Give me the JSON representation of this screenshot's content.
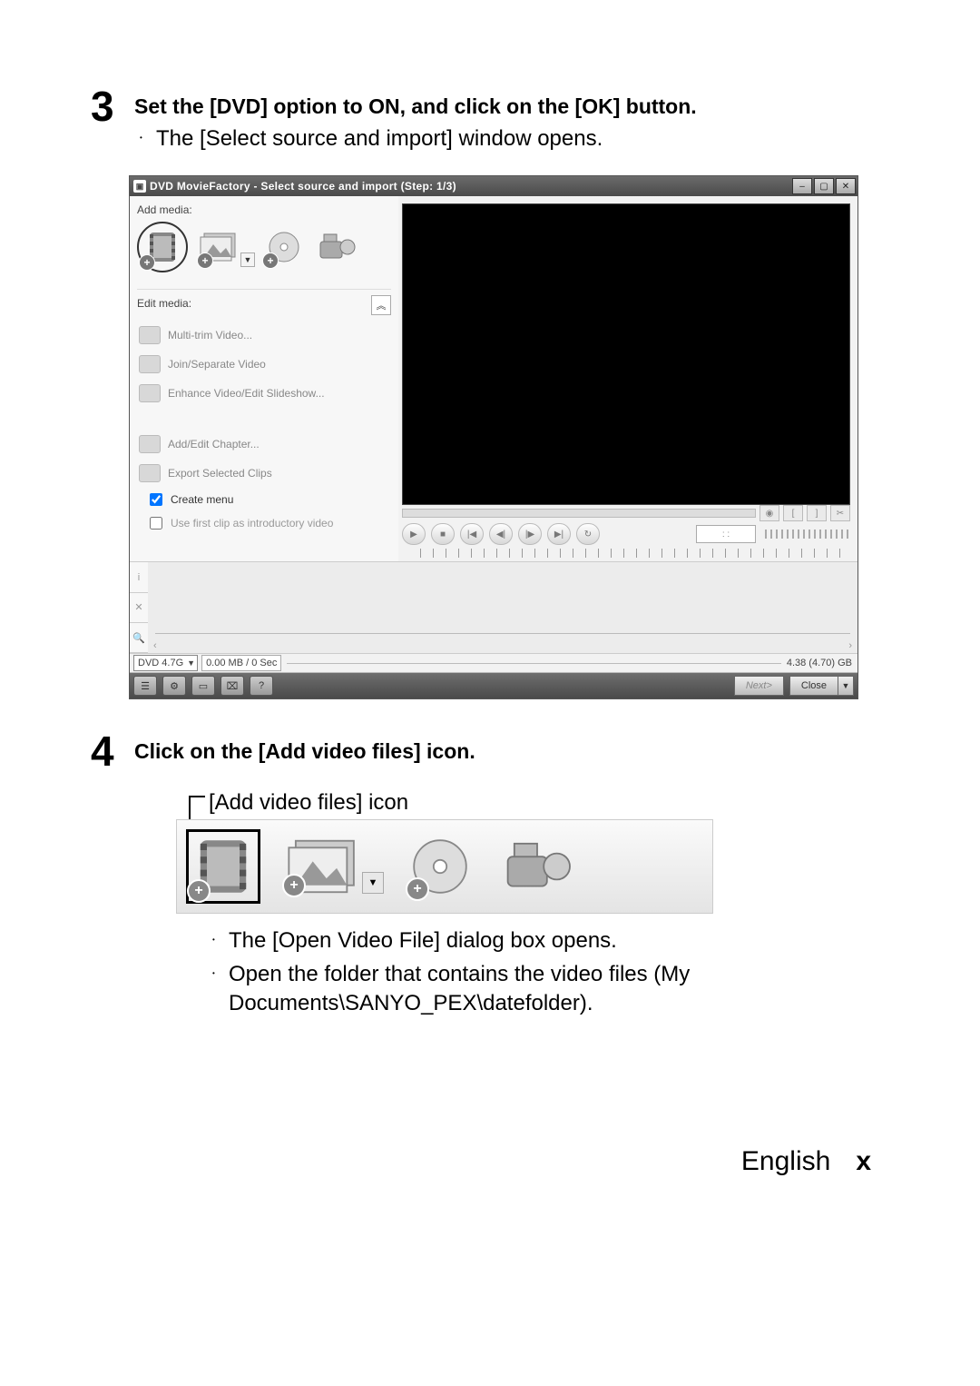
{
  "step3": {
    "num": "3",
    "title": "Set the [DVD] option to ON, and click on the [OK] button.",
    "bullet1": "The [Select source and import] window opens."
  },
  "step4": {
    "num": "4",
    "title": "Click on the [Add video files] icon.",
    "callout_label": "[Add video files] icon",
    "bullet1": "The [Open Video File] dialog box opens.",
    "bullet2": "Open the folder that contains the video files (My Documents\\SANYO_PEX\\datefolder)."
  },
  "app": {
    "title": "DVD MovieFactory - Select source and import (Step: 1/3)",
    "left": {
      "add_label": "Add media:",
      "edit_label": "Edit media:",
      "edit_items": {
        "multi_trim": "Multi-trim Video...",
        "join_sep": "Join/Separate Video",
        "enhance": "Enhance Video/Edit Slideshow...",
        "chapter": "Add/Edit Chapter...",
        "export": "Export Selected Clips"
      },
      "create_menu": "Create menu",
      "use_first": "Use first clip as introductory video"
    },
    "controls": {
      "tc": ":   :"
    },
    "status": {
      "disc": "DVD 4.7G",
      "used": "0.00 MB / 0 Sec",
      "total": "4.38 (4.70) GB"
    },
    "footer": {
      "next": "Next>",
      "close": "Close"
    }
  },
  "footer": {
    "lang": "English",
    "page": "x"
  }
}
